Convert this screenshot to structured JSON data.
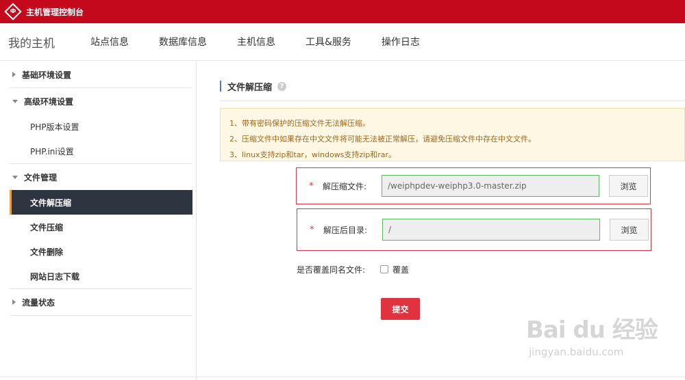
{
  "topbar": {
    "logo_text": "Ф",
    "title": "主机管理控制台"
  },
  "nav": {
    "brand": "我的主机",
    "items": [
      {
        "label": "站点信息"
      },
      {
        "label": "数据库信息"
      },
      {
        "label": "主机信息"
      },
      {
        "label": "工具&服务"
      },
      {
        "label": "操作日志"
      }
    ]
  },
  "sidebar": {
    "groups": [
      {
        "label": "基础环境设置",
        "expanded": false,
        "items": []
      },
      {
        "label": "高级环境设置",
        "expanded": true,
        "items": [
          {
            "label": "PHP版本设置"
          },
          {
            "label": "PHP.ini设置"
          }
        ]
      },
      {
        "label": "文件管理",
        "expanded": true,
        "items": [
          {
            "label": "文件解压缩",
            "active": true
          },
          {
            "label": "文件压缩"
          },
          {
            "label": "文件删除"
          },
          {
            "label": "网站日志下载"
          }
        ]
      },
      {
        "label": "流量状态",
        "expanded": false,
        "items": []
      }
    ]
  },
  "main": {
    "title": "文件解压缩",
    "help_icon": "?",
    "notice": [
      "1、带有密码保护的压缩文件无法解压缩。",
      "2、压缩文件中如果存在中文文件将可能无法被正常解压，请避免压缩文件中存在中文文件。",
      "3、linux支持zip和tar，windows支持zip和rar。"
    ],
    "form": {
      "required_mark": "*",
      "archive_label": "解压缩文件:",
      "archive_value": "/weiphpdev-weiphp3.0-master.zip",
      "target_label": "解压后目录:",
      "target_value": "/",
      "browse_label": "浏览",
      "overwrite_label": "是否覆盖同名文件:",
      "overwrite_option": "覆盖",
      "overwrite_checked": false,
      "submit_label": "提交"
    }
  },
  "watermark": {
    "logo": "Bai du 经验",
    "url": "jingyan.baidu.com"
  },
  "colors": {
    "brand_red": "#c5091d",
    "sidebar_active": "#2e3440",
    "notice_bg": "#fdf7e3",
    "submit": "#e0333f"
  }
}
